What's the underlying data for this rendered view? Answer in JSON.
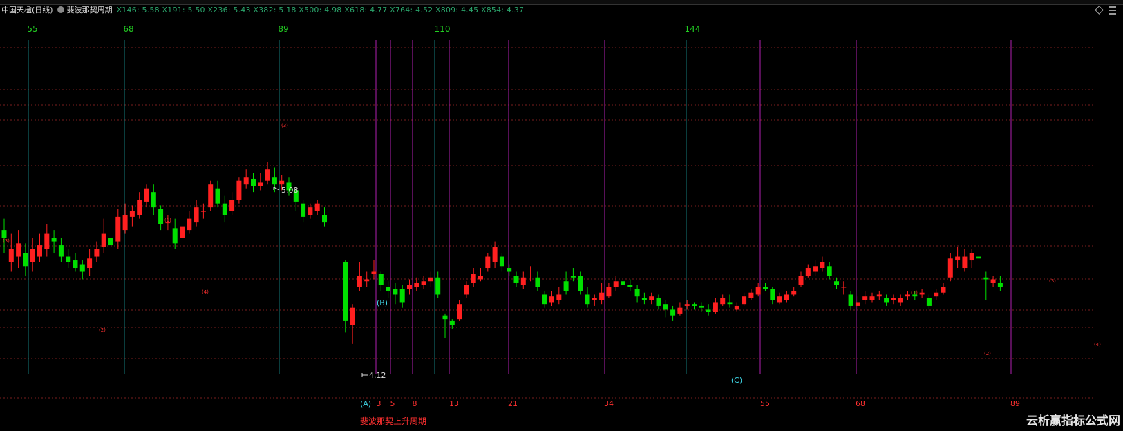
{
  "header": {
    "stock_title": "中国天楹(日线)",
    "indicator_name": "斐波那契周期",
    "values_text": "X146: 5.58  X191: 5.50  X236: 5.43  X382: 5.18  X500: 4.98  X618: 4.77  X764: 4.52  X809: 4.45  X854: 4.37"
  },
  "fib_levels": [
    5.58,
    5.5,
    5.43,
    5.18,
    4.98,
    4.77,
    4.52,
    4.45,
    4.37
  ],
  "colors": {
    "up": "#ff2020",
    "down": "#00e000",
    "teal_line": "#137a7a",
    "magenta_line": "#b020b0",
    "green_label": "#22cc22",
    "red_label": "#ff3030",
    "cyan_label": "#40d8e8",
    "dotted": "#7a1e1e"
  },
  "top_cycle_labels": [
    "55",
    "68",
    "89",
    "110",
    "144"
  ],
  "bottom_cycle_labels": [
    "3",
    "5",
    "8",
    "13",
    "21",
    "34",
    "55",
    "68",
    "89"
  ],
  "wave_labels": {
    "A": "(A)",
    "B": "(B)",
    "C": "(C)"
  },
  "annotations": {
    "high": "5.08",
    "low": "4.12",
    "cycle_name": "斐波那契上升周期"
  },
  "wave_marks": [
    "(1)",
    "(2)",
    "(3)",
    "(4)",
    "(5)"
  ],
  "watermark": "云析赢指标公式网",
  "chart_data": {
    "type": "candlestick",
    "price_range": [
      3.85,
      5.7
    ],
    "labeled_high": 5.08,
    "labeled_low": 4.12,
    "candles": [
      [
        4.72,
        4.68,
        4.78,
        4.6
      ],
      [
        4.55,
        4.62,
        4.7,
        4.5
      ],
      [
        4.58,
        4.65,
        4.72,
        4.52
      ],
      [
        4.6,
        4.53,
        4.65,
        4.48
      ],
      [
        4.55,
        4.62,
        4.68,
        4.5
      ],
      [
        4.58,
        4.64,
        4.7,
        4.55
      ],
      [
        4.62,
        4.7,
        4.75,
        4.58
      ],
      [
        4.68,
        4.66,
        4.72,
        4.6
      ],
      [
        4.64,
        4.58,
        4.68,
        4.55
      ],
      [
        4.58,
        4.55,
        4.62,
        4.52
      ],
      [
        4.56,
        4.52,
        4.6,
        4.5
      ],
      [
        4.54,
        4.5,
        4.56,
        4.46
      ],
      [
        4.52,
        4.57,
        4.62,
        4.48
      ],
      [
        4.58,
        4.62,
        4.66,
        4.55
      ],
      [
        4.63,
        4.7,
        4.78,
        4.6
      ],
      [
        4.68,
        4.64,
        4.72,
        4.6
      ],
      [
        4.66,
        4.79,
        4.83,
        4.62
      ],
      [
        4.72,
        4.8,
        4.86,
        4.7
      ],
      [
        4.79,
        4.82,
        4.85,
        4.74
      ],
      [
        4.8,
        4.88,
        4.92,
        4.78
      ],
      [
        4.87,
        4.94,
        4.96,
        4.84
      ],
      [
        4.92,
        4.84,
        4.96,
        4.8
      ],
      [
        4.83,
        4.75,
        4.85,
        4.72
      ],
      [
        4.76,
        4.76,
        4.8,
        4.72
      ],
      [
        4.73,
        4.65,
        4.78,
        4.62
      ],
      [
        4.68,
        4.74,
        4.8,
        4.66
      ],
      [
        4.72,
        4.78,
        4.82,
        4.7
      ],
      [
        4.76,
        4.84,
        4.88,
        4.74
      ],
      [
        4.82,
        4.82,
        4.86,
        4.78
      ],
      [
        4.84,
        4.96,
        4.98,
        4.82
      ],
      [
        4.94,
        4.86,
        4.98,
        4.84
      ],
      [
        4.86,
        4.8,
        4.9,
        4.76
      ],
      [
        4.82,
        4.88,
        4.92,
        4.8
      ],
      [
        4.88,
        4.98,
        5.0,
        4.86
      ],
      [
        4.96,
        5.0,
        5.04,
        4.94
      ],
      [
        4.99,
        4.95,
        5.02,
        4.92
      ],
      [
        4.95,
        4.97,
        5.02,
        4.93
      ],
      [
        4.98,
        5.04,
        5.08,
        4.96
      ],
      [
        5.0,
        4.96,
        5.05,
        4.92
      ],
      [
        4.96,
        4.98,
        5.01,
        4.93
      ],
      [
        4.97,
        4.93,
        5.0,
        4.9
      ],
      [
        4.93,
        4.87,
        4.94,
        4.82
      ],
      [
        4.86,
        4.79,
        4.88,
        4.76
      ],
      [
        4.8,
        4.84,
        4.86,
        4.78
      ],
      [
        4.82,
        4.86,
        4.88,
        4.8
      ],
      [
        4.8,
        4.76,
        4.84,
        4.74
      ],
      [
        4.55,
        4.24,
        4.56,
        4.18
      ],
      [
        4.22,
        4.31,
        4.33,
        4.12
      ],
      [
        4.42,
        4.48,
        4.55,
        4.4
      ],
      [
        4.45,
        4.46,
        4.5,
        4.42
      ],
      [
        4.49,
        4.5,
        4.56,
        4.46
      ],
      [
        4.49,
        4.43,
        4.5,
        4.4
      ],
      [
        4.42,
        4.4,
        4.45,
        4.36
      ],
      [
        4.41,
        4.38,
        4.44,
        4.33
      ],
      [
        4.41,
        4.34,
        4.43,
        4.31
      ],
      [
        4.41,
        4.43,
        4.46,
        4.38
      ],
      [
        4.42,
        4.44,
        4.47,
        4.4
      ],
      [
        4.43,
        4.45,
        4.48,
        4.41
      ],
      [
        4.45,
        4.47,
        4.5,
        4.42
      ],
      [
        4.47,
        4.38,
        4.5,
        4.36
      ],
      [
        4.27,
        4.25,
        4.28,
        4.15
      ],
      [
        4.24,
        4.22,
        4.25,
        4.2
      ],
      [
        4.25,
        4.33,
        4.35,
        4.24
      ],
      [
        4.38,
        4.43,
        4.45,
        4.36
      ],
      [
        4.44,
        4.49,
        4.52,
        4.42
      ],
      [
        4.46,
        4.48,
        4.52,
        4.45
      ],
      [
        4.52,
        4.58,
        4.6,
        4.5
      ],
      [
        4.55,
        4.63,
        4.66,
        4.52
      ],
      [
        4.58,
        4.53,
        4.6,
        4.5
      ],
      [
        4.52,
        4.5,
        4.54,
        4.48
      ],
      [
        4.48,
        4.44,
        4.5,
        4.42
      ],
      [
        4.43,
        4.47,
        4.5,
        4.41
      ],
      [
        4.48,
        4.48,
        4.53,
        4.45
      ],
      [
        4.47,
        4.42,
        4.5,
        4.4
      ],
      [
        4.38,
        4.33,
        4.4,
        4.31
      ],
      [
        4.34,
        4.37,
        4.4,
        4.32
      ],
      [
        4.35,
        4.38,
        4.42,
        4.33
      ],
      [
        4.45,
        4.4,
        4.5,
        4.38
      ],
      [
        4.48,
        4.47,
        4.52,
        4.45
      ],
      [
        4.48,
        4.4,
        4.5,
        4.38
      ],
      [
        4.38,
        4.33,
        4.42,
        4.31
      ],
      [
        4.35,
        4.36,
        4.38,
        4.32
      ],
      [
        4.35,
        4.39,
        4.44,
        4.33
      ],
      [
        4.37,
        4.42,
        4.44,
        4.36
      ],
      [
        4.42,
        4.45,
        4.48,
        4.4
      ],
      [
        4.45,
        4.43,
        4.48,
        4.42
      ],
      [
        4.43,
        4.42,
        4.46,
        4.4
      ],
      [
        4.41,
        4.37,
        4.43,
        4.34
      ],
      [
        4.36,
        4.35,
        4.39,
        4.33
      ],
      [
        4.35,
        4.37,
        4.39,
        4.33
      ],
      [
        4.36,
        4.32,
        4.38,
        4.3
      ],
      [
        4.33,
        4.3,
        4.35,
        4.26
      ],
      [
        4.3,
        4.27,
        4.32,
        4.24
      ],
      [
        4.28,
        4.31,
        4.34,
        4.27
      ],
      [
        4.32,
        4.33,
        4.35,
        4.3
      ],
      [
        4.33,
        4.32,
        4.34,
        4.3
      ],
      [
        4.32,
        4.31,
        4.34,
        4.29
      ],
      [
        4.3,
        4.29,
        4.33,
        4.27
      ],
      [
        4.29,
        4.34,
        4.36,
        4.28
      ],
      [
        4.33,
        4.36,
        4.38,
        4.32
      ],
      [
        4.34,
        4.33,
        4.38,
        4.31
      ],
      [
        4.3,
        4.32,
        4.34,
        4.29
      ],
      [
        4.33,
        4.37,
        4.39,
        4.32
      ],
      [
        4.36,
        4.39,
        4.41,
        4.35
      ],
      [
        4.38,
        4.42,
        4.44,
        4.37
      ],
      [
        4.42,
        4.41,
        4.44,
        4.4
      ],
      [
        4.41,
        4.35,
        4.42,
        4.33
      ],
      [
        4.34,
        4.37,
        4.39,
        4.33
      ],
      [
        4.35,
        4.38,
        4.4,
        4.34
      ],
      [
        4.38,
        4.4,
        4.42,
        4.37
      ],
      [
        4.43,
        4.48,
        4.5,
        4.42
      ],
      [
        4.48,
        4.52,
        4.54,
        4.47
      ],
      [
        4.5,
        4.53,
        4.56,
        4.48
      ],
      [
        4.52,
        4.55,
        4.58,
        4.5
      ],
      [
        4.53,
        4.48,
        4.55,
        4.46
      ],
      [
        4.45,
        4.43,
        4.47,
        4.41
      ],
      [
        4.42,
        4.42,
        4.45,
        4.38
      ],
      [
        4.38,
        4.32,
        4.4,
        4.3
      ],
      [
        4.32,
        4.34,
        4.37,
        4.3
      ],
      [
        4.35,
        4.37,
        4.4,
        4.33
      ],
      [
        4.35,
        4.37,
        4.39,
        4.34
      ],
      [
        4.37,
        4.38,
        4.4,
        4.35
      ],
      [
        4.36,
        4.34,
        4.38,
        4.32
      ],
      [
        4.35,
        4.36,
        4.38,
        4.33
      ],
      [
        4.34,
        4.36,
        4.38,
        4.32
      ],
      [
        4.37,
        4.38,
        4.4,
        4.35
      ],
      [
        4.38,
        4.37,
        4.4,
        4.35
      ],
      [
        4.38,
        4.39,
        4.41,
        4.36
      ],
      [
        4.36,
        4.32,
        4.38,
        4.3
      ],
      [
        4.37,
        4.39,
        4.41,
        4.35
      ],
      [
        4.39,
        4.42,
        4.44,
        4.38
      ],
      [
        4.47,
        4.57,
        4.6,
        4.45
      ],
      [
        4.56,
        4.58,
        4.63,
        4.52
      ],
      [
        4.52,
        4.58,
        4.62,
        4.5
      ],
      [
        4.56,
        4.6,
        4.62,
        4.52
      ],
      [
        4.58,
        4.57,
        4.63,
        4.53
      ],
      [
        4.47,
        4.46,
        4.5,
        4.35
      ],
      [
        4.44,
        4.46,
        4.48,
        4.42
      ],
      [
        4.44,
        4.42,
        4.48,
        4.4
      ]
    ],
    "top_cycle_lines_at": [
      2,
      18,
      45,
      63,
      117
    ],
    "bottom_cycle_lines_at": [
      63,
      65,
      68,
      71,
      73,
      83,
      98,
      124,
      140,
      165
    ]
  }
}
